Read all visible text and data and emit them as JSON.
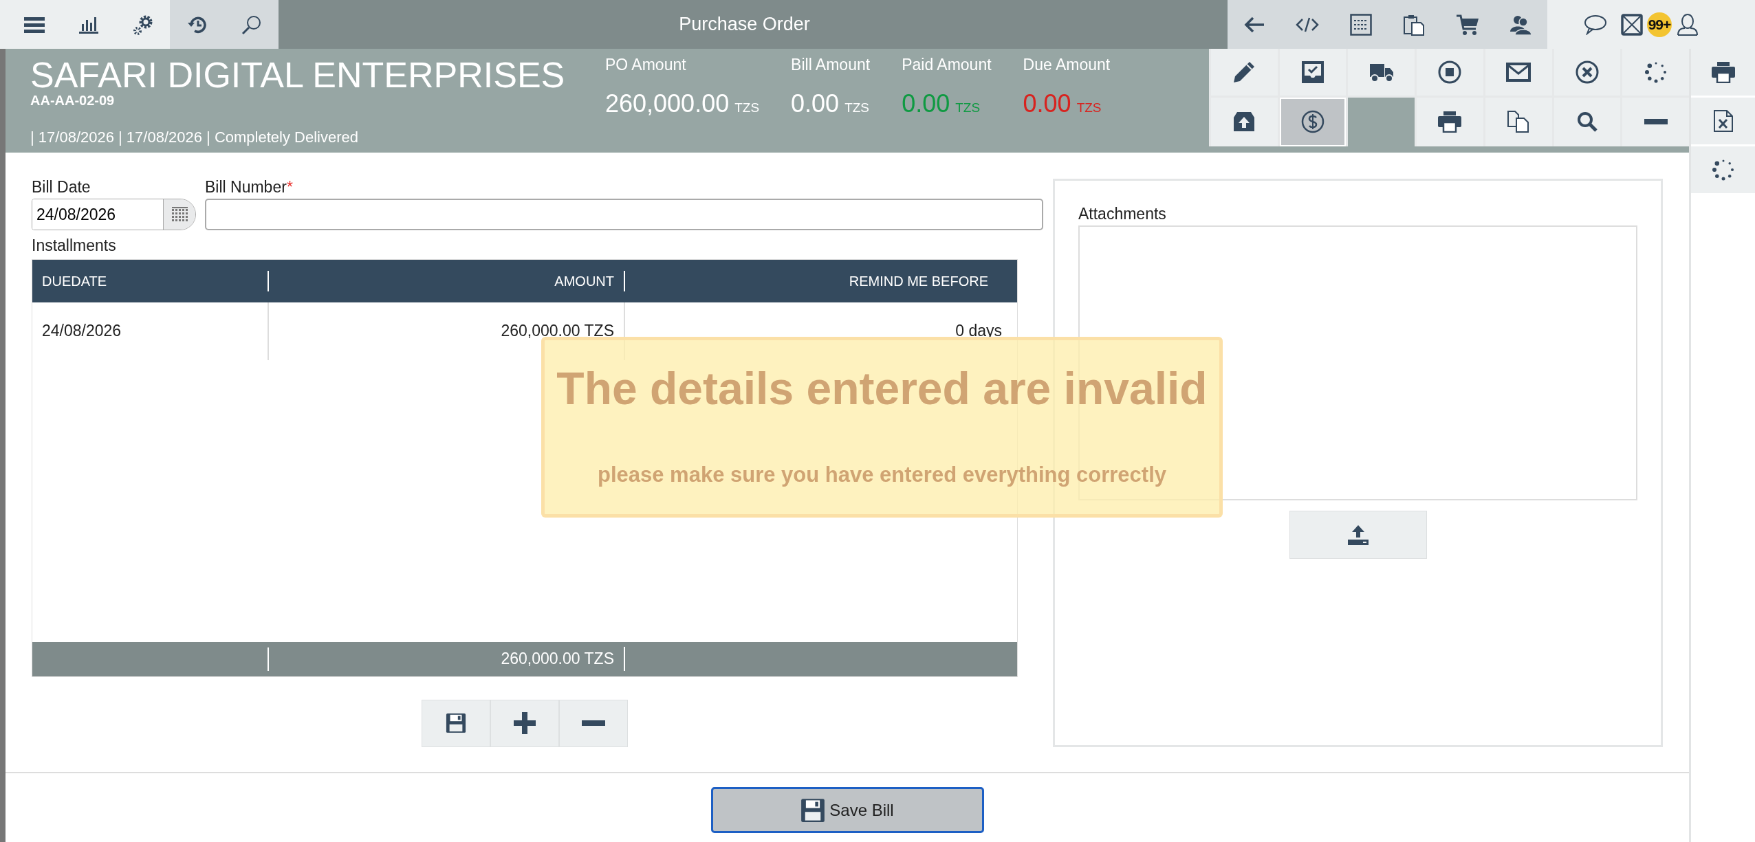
{
  "top_bar": {
    "title": "Purchase Order",
    "badge": "99+"
  },
  "header": {
    "company": "SAFARI DIGITAL ENTERPRISES",
    "code": "AA-AA-02-09",
    "info": "| 17/08/2026 | 17/08/2026 | Completely Delivered",
    "amounts": [
      {
        "label": "PO Amount",
        "value": "260,000.00",
        "currency": "TZS",
        "color": "#ffffff"
      },
      {
        "label": "Bill Amount",
        "value": "0.00",
        "currency": "TZS",
        "color": "#ffffff"
      },
      {
        "label": "Paid Amount",
        "value": "0.00",
        "currency": "TZS",
        "color": "#0f9a42"
      },
      {
        "label": "Due Amount",
        "value": "0.00",
        "currency": "TZS",
        "color": "#d8231f"
      }
    ]
  },
  "actions": [
    {
      "kind": "button",
      "selected": false
    },
    {
      "kind": "button",
      "selected": false
    },
    {
      "kind": "button",
      "selected": false
    },
    {
      "kind": "button",
      "selected": false
    },
    {
      "kind": "button",
      "selected": false
    },
    {
      "kind": "button",
      "selected": false
    },
    {
      "kind": "button",
      "selected": false
    },
    {
      "kind": "button",
      "selected": false
    },
    {
      "kind": "button",
      "selected": true
    },
    {
      "kind": "blank"
    },
    {
      "kind": "button",
      "selected": false
    },
    {
      "kind": "button",
      "selected": false
    },
    {
      "kind": "button",
      "selected": false
    },
    {
      "kind": "button",
      "selected": false
    }
  ],
  "form": {
    "bill_date": {
      "label": "Bill Date",
      "value": "24/08/2026"
    },
    "bill_number": {
      "label": "Bill Number",
      "required_mark": "*"
    },
    "installments_label": "Installments"
  },
  "table": {
    "columns": [
      "DUEDATE",
      "AMOUNT",
      "REMIND ME BEFORE"
    ],
    "rows": [
      [
        "24/08/2026",
        "260,000.00 TZS",
        "0 days"
      ]
    ],
    "footer_amount": "260,000.00 TZS"
  },
  "attachments": {
    "label": "Attachments"
  },
  "alert": {
    "title": "The details entered are invalid",
    "message": "please make sure you have entered everything correctly"
  },
  "save_button": "Save Bill"
}
